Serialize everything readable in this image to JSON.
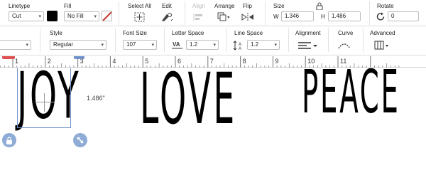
{
  "toolbar1": {
    "linetype": {
      "label": "Linetype",
      "value": "Cut"
    },
    "fill": {
      "label": "Fill",
      "value": "No Fill"
    },
    "select_all": {
      "label": "Select All"
    },
    "edit": {
      "label": "Edit"
    },
    "align": {
      "label": "Align"
    },
    "arrange": {
      "label": "Arrange"
    },
    "flip": {
      "label": "Flip"
    },
    "size": {
      "label": "Size",
      "w_label": "W",
      "w_value": "1.346",
      "h_label": "H",
      "h_value": "1.486"
    },
    "rotate": {
      "label": "Rotate",
      "value": "0"
    }
  },
  "toolbar2": {
    "style": {
      "label": "Style",
      "value": "Regular"
    },
    "font_size": {
      "label": "Font Size",
      "value": "107"
    },
    "letter_space": {
      "label": "Letter Space",
      "value": "1.2"
    },
    "line_space": {
      "label": "Line Space",
      "value": "1.2"
    },
    "alignment": {
      "label": "Alignment"
    },
    "curve": {
      "label": "Curve"
    },
    "advanced": {
      "label": "Advanced"
    }
  },
  "ruler": {
    "ticks": [
      "1",
      "2",
      "3",
      "4",
      "5",
      "6",
      "7",
      "8",
      "9",
      "10",
      "11"
    ]
  },
  "canvas": {
    "words": [
      "JOY",
      "LOVE",
      "PEACE"
    ],
    "height_label": "1.486\""
  },
  "colors": {
    "fill_swatch": "#000000",
    "selection": "#6f93c8",
    "handle": "#8eacd6"
  },
  "icons": {
    "select_all": "select-all-icon",
    "edit": "edit-tools-icon",
    "align": "align-icon",
    "arrange": "arrange-icon",
    "flip": "flip-icon",
    "lock": "lock-icon",
    "rotate": "rotate-icon",
    "letter_space": "letter-space-icon",
    "line_space": "line-space-icon",
    "alignment": "text-align-icon",
    "curve": "curve-icon",
    "advanced": "advanced-icon",
    "lock_handle": "lock-handle-icon",
    "resize_handle": "resize-handle-icon"
  }
}
